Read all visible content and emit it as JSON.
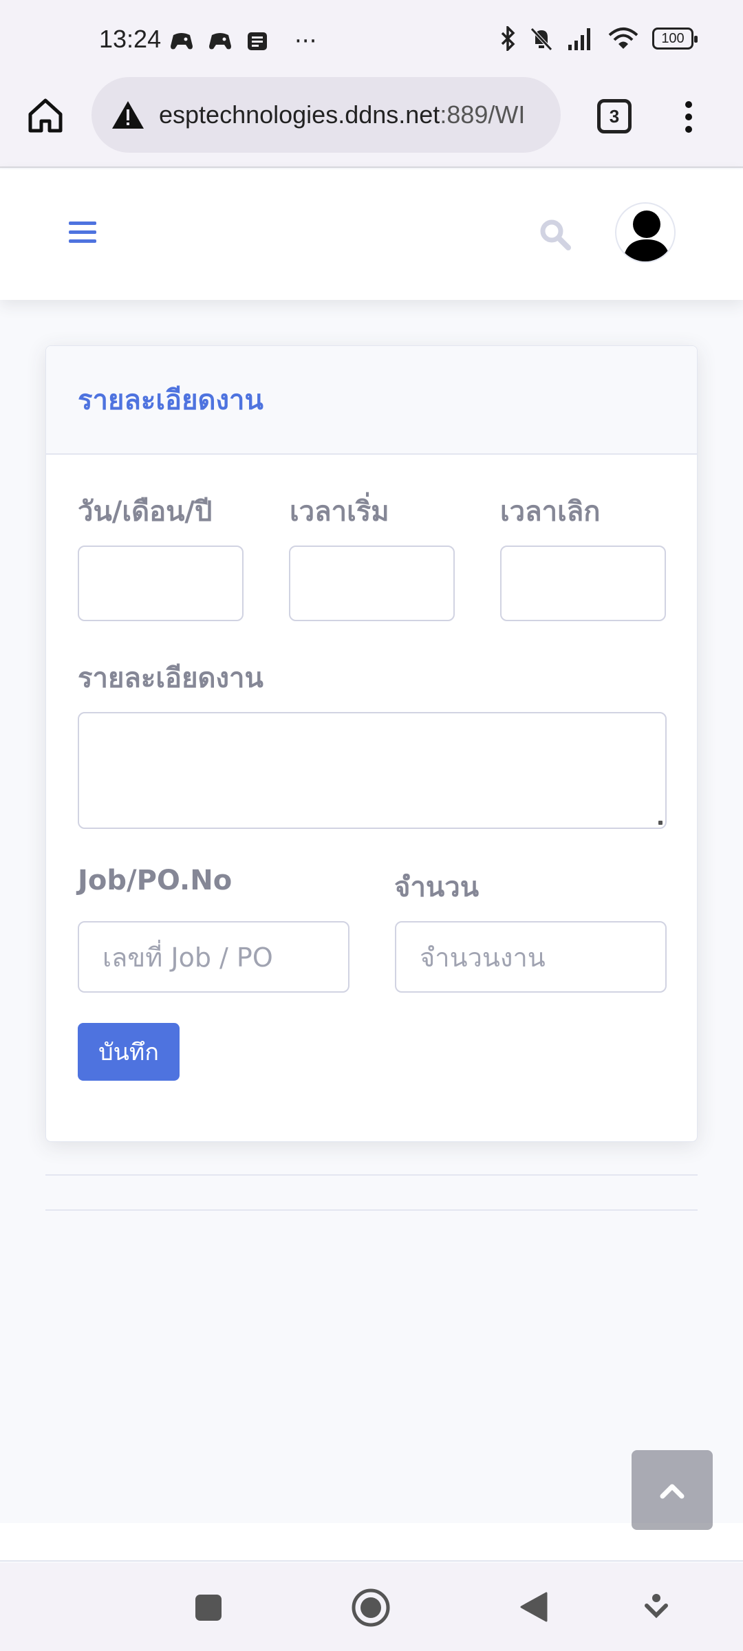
{
  "status_bar": {
    "time": "13:24",
    "ellipsis": "···",
    "battery": "100",
    "icons": [
      "game-controller-icon",
      "game-controller-icon",
      "news-icon",
      "bluetooth-icon",
      "mute-icon",
      "signal-icon",
      "wifi-icon",
      "battery-icon"
    ]
  },
  "browser": {
    "url_host": "esptechnologies.ddns.net",
    "url_path": ":889/WI",
    "tab_count": "3"
  },
  "page": {
    "card_title": "รายละเอียดงาน",
    "form": {
      "date_label": "วัน/เดือน/ปี",
      "start_label": "เวลาเริ่ม",
      "end_label": "เวลาเลิก",
      "detail_label": "รายละเอียดงาน",
      "job_label": "Job/PO.No",
      "qty_label": "จำนวน",
      "job_placeholder": "เลขที่ Job / PO",
      "qty_placeholder": "จำนวนงาน",
      "date_value": "",
      "start_value": "",
      "end_value": "",
      "detail_value": "",
      "save_label": "บันทึก"
    }
  },
  "colors": {
    "primary": "#4e73df",
    "label": "#858796",
    "background": "#f8f9fc"
  }
}
